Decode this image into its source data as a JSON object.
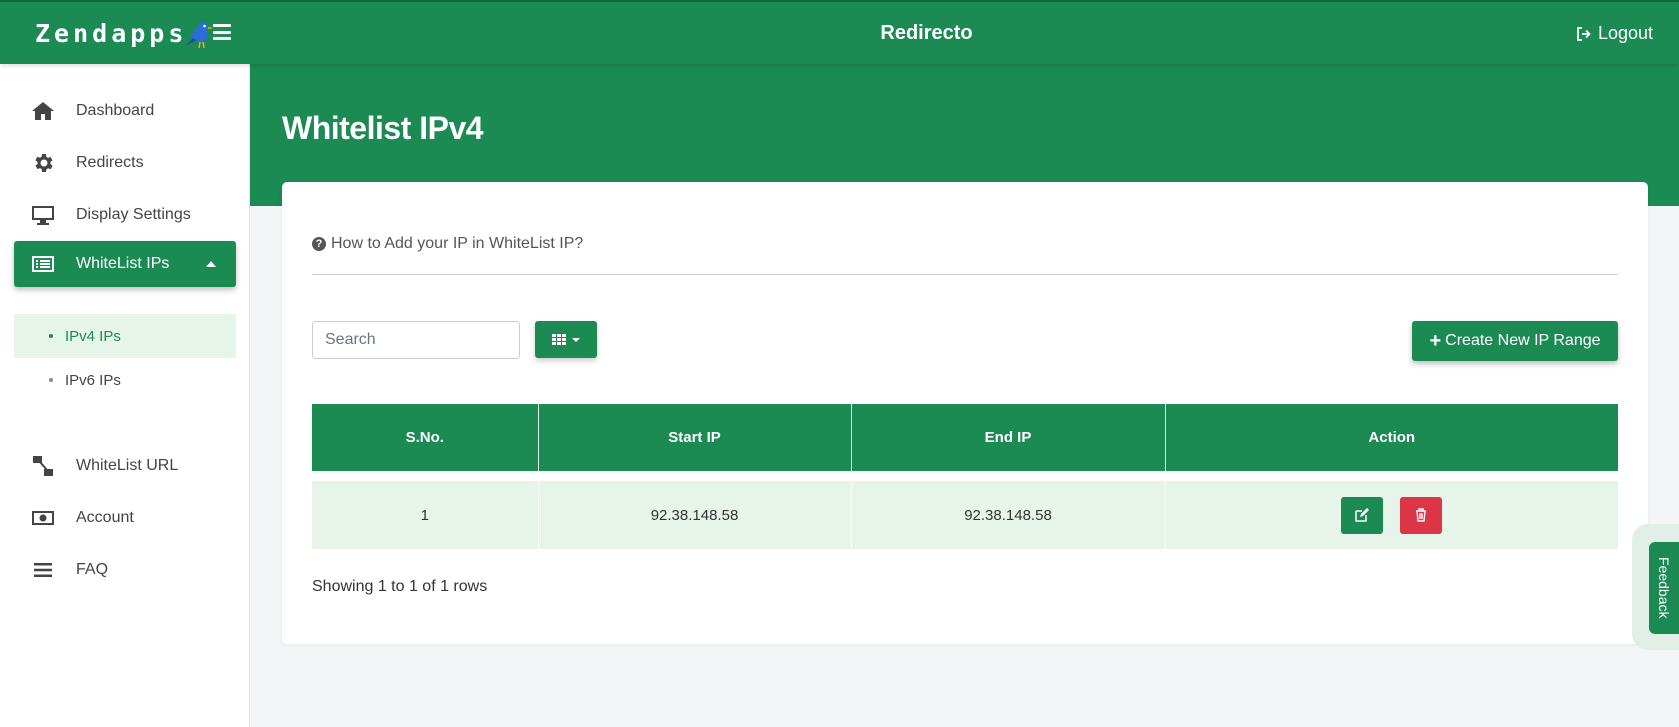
{
  "header": {
    "brand": "Zendapps",
    "app_title": "Redirecto",
    "logout_label": "Logout"
  },
  "sidebar": {
    "items": [
      {
        "label": "Dashboard",
        "icon": "home-icon"
      },
      {
        "label": "Redirects",
        "icon": "gear-icon"
      },
      {
        "label": "Display Settings",
        "icon": "monitor-icon"
      },
      {
        "label": "WhiteList IPs",
        "icon": "list-icon"
      },
      {
        "label": "WhiteList URL",
        "icon": "link-icon"
      },
      {
        "label": "Account",
        "icon": "money-icon"
      },
      {
        "label": "FAQ",
        "icon": "bars-icon"
      }
    ],
    "subitems": [
      {
        "label": "IPv4 IPs"
      },
      {
        "label": "IPv6 IPs"
      }
    ]
  },
  "main": {
    "title": "Whitelist IPv4",
    "help_text": "How to Add your IP in WhiteList IP?",
    "search_placeholder": "Search",
    "create_label": "Create New IP Range",
    "table": {
      "headers": [
        "S.No.",
        "Start IP",
        "End IP",
        "Action"
      ],
      "rows": [
        {
          "sno": "1",
          "start_ip": "92.38.148.58",
          "end_ip": "92.38.148.58"
        }
      ]
    },
    "showing_text": "Showing 1 to 1 of 1 rows"
  },
  "feedback_label": "Feedback",
  "colors": {
    "primary": "#1b8a53",
    "row_highlight": "#e6f4ea",
    "danger": "#dc3545"
  }
}
